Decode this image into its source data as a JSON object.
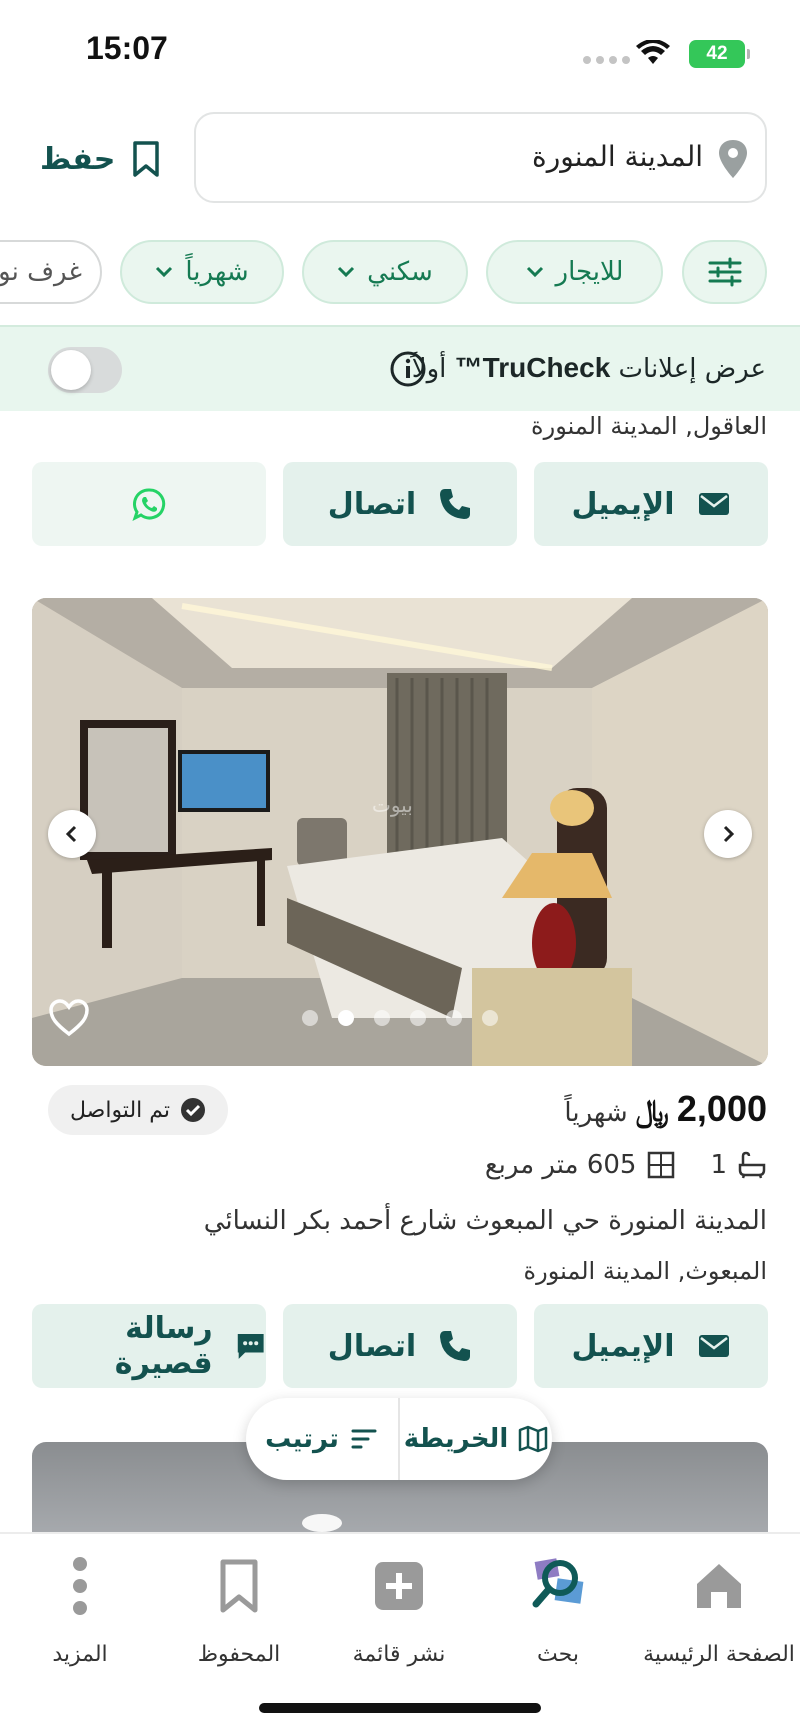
{
  "status_bar": {
    "time": "15:07",
    "battery": "42"
  },
  "search": {
    "query": "المدينة المنورة",
    "save_label": "حفظ"
  },
  "filters": {
    "chips": [
      {
        "label": "للايجار"
      },
      {
        "label": "سكني"
      },
      {
        "label": "شهرياً"
      },
      {
        "label": "غرف نوم"
      }
    ]
  },
  "trucheck": {
    "label_prefix": "عرض إعلانات",
    "brand": "TruCheck™",
    "label_suffix": "أولاً",
    "enabled": false
  },
  "listing_previous": {
    "location": "العاقول, المدينة المنورة",
    "actions": {
      "email": "الإيميل",
      "call": "اتصال"
    }
  },
  "listing": {
    "photo_count": 6,
    "active_photo": 2,
    "contacted_badge": "تم التواصل",
    "price": "2,000",
    "currency": "﷼",
    "period": "شهرياً",
    "bathrooms": "1",
    "area": "605 متر مربع",
    "address": "المدينة المنورة حي المبعوث شارع أحمد بكر النسائي",
    "location": "المبعوث, المدينة المنورة",
    "actions": {
      "email": "الإيميل",
      "call": "اتصال",
      "sms": "رسالة قصيرة"
    }
  },
  "floating": {
    "map_label": "الخريطة",
    "sort_label": "ترتيب"
  },
  "bottom_nav": {
    "home": "الصفحة الرئيسية",
    "search": "بحث",
    "post": "نشر قائمة",
    "saved": "المحفوظ",
    "more": "المزيد"
  },
  "colors": {
    "brand_dark": "#13524f",
    "brand_green": "#157a52",
    "chip_bg": "#eaf6ef",
    "whatsapp": "#25d366"
  }
}
